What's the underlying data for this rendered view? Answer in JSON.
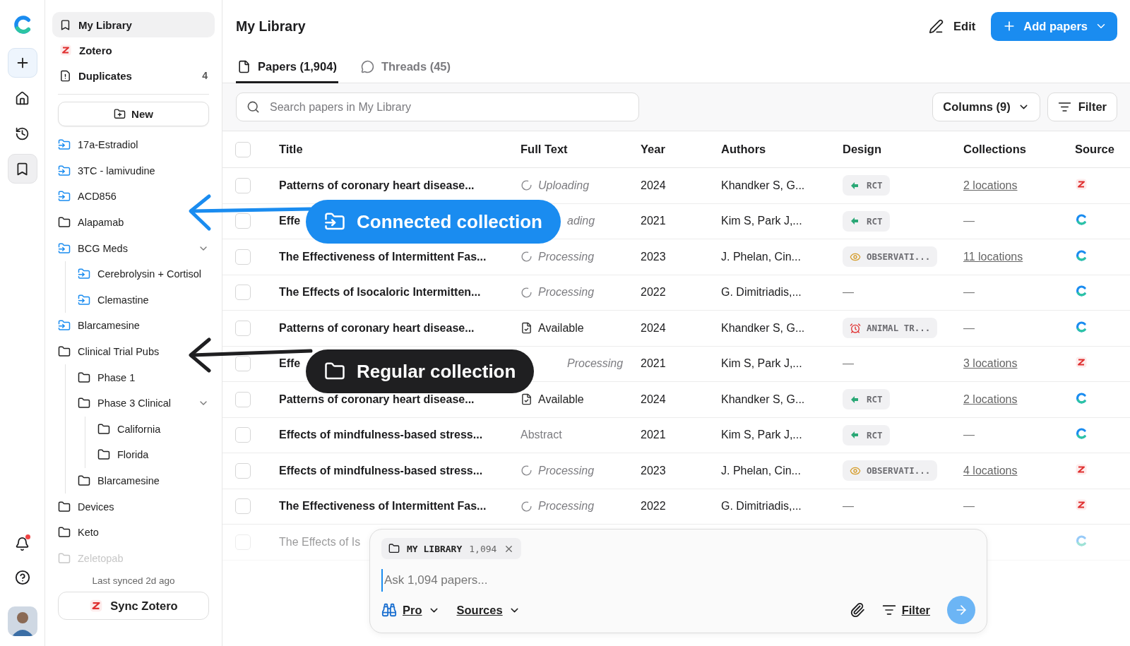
{
  "rail": {
    "nav": [
      {
        "kind": "new",
        "selected": false
      },
      {
        "kind": "home",
        "selected": false
      },
      {
        "kind": "history",
        "selected": false
      },
      {
        "kind": "library",
        "selected": true
      }
    ],
    "notifications_unread": true
  },
  "sidebar": {
    "top": [
      {
        "kind": "library",
        "label": "My Library",
        "selected": true
      },
      {
        "kind": "zotero",
        "label": "Zotero",
        "selected": false
      },
      {
        "kind": "duplicates",
        "label": "Duplicates",
        "count": "4",
        "selected": false
      }
    ],
    "new_button": "New",
    "collections": [
      {
        "label": "17a-Estradiol",
        "kind": "connected",
        "disabled": false
      },
      {
        "label": "3TC - lamivudine",
        "kind": "connected",
        "disabled": false
      },
      {
        "label": "ACD856",
        "kind": "connected",
        "disabled": false
      },
      {
        "label": "Alapamab",
        "kind": "folder",
        "disabled": false
      },
      {
        "label": "BCG Meds",
        "kind": "connected",
        "disabled": false,
        "expanded": true,
        "children": [
          {
            "label": "Cerebrolysin + Cortisol",
            "kind": "connected",
            "disabled": false
          },
          {
            "label": "Clemastine",
            "kind": "connected",
            "disabled": false
          }
        ]
      },
      {
        "label": "Blarcamesine",
        "kind": "connected",
        "disabled": false
      },
      {
        "label": "Clinical Trial Pubs",
        "kind": "folder",
        "disabled": false,
        "children": [
          {
            "label": "Phase 1",
            "kind": "folder",
            "disabled": false
          },
          {
            "label": "Phase 3 Clinical",
            "kind": "folder",
            "disabled": false,
            "expanded": true,
            "children": [
              {
                "label": "California",
                "kind": "folder",
                "disabled": false
              },
              {
                "label": "Florida",
                "kind": "folder",
                "disabled": false
              }
            ]
          },
          {
            "label": "Blarcamesine",
            "kind": "folder",
            "disabled": false
          }
        ]
      },
      {
        "label": "Devices",
        "kind": "folder",
        "disabled": false
      },
      {
        "label": "Keto",
        "kind": "folder",
        "disabled": false
      },
      {
        "label": "Zeletopab",
        "kind": "folder",
        "disabled": true
      }
    ],
    "sync_status": "Last synced 2d ago",
    "sync_button": "Sync Zotero"
  },
  "header": {
    "title": "My Library",
    "edit": "Edit",
    "add": "Add papers"
  },
  "tabs": [
    {
      "kind": "papers",
      "label": "Papers (1,904)",
      "selected": true
    },
    {
      "kind": "threads",
      "label": "Threads (45)",
      "selected": false
    }
  ],
  "search": {
    "placeholder": "Search papers in My Library"
  },
  "columns_button": "Columns (9)",
  "filter_button": "Filter",
  "table": {
    "select_all": false,
    "columns": [
      "Title",
      "Full Text",
      "Year",
      "Authors",
      "Design",
      "Collections",
      "Source"
    ],
    "rows": [
      {
        "checked": false,
        "faded": false,
        "title": "Patterns of coronary heart disease...",
        "full_text": {
          "kind": "pending",
          "text": "Uploading",
          "icon": true
        },
        "year": "2024",
        "authors": "Khandker S, G...",
        "design": {
          "kind": "rct",
          "label": "RCT"
        },
        "collections": {
          "kind": "link",
          "text": "2 locations"
        },
        "source": {
          "kind": "zotero"
        }
      },
      {
        "checked": false,
        "faded": false,
        "title": "Effe",
        "full_text": {
          "kind": "pending",
          "text": "ading",
          "icon": false
        },
        "year": "2021",
        "authors": "Kim S, Park J,...",
        "design": {
          "kind": "rct",
          "label": "RCT"
        },
        "collections": {
          "kind": "none",
          "text": "—"
        },
        "source": {
          "kind": "consensus"
        }
      },
      {
        "checked": false,
        "faded": false,
        "title": "The Effectiveness of Intermittent Fas...",
        "full_text": {
          "kind": "pending",
          "text": "Processing",
          "icon": true
        },
        "year": "2023",
        "authors": "J. Phelan, Cin...",
        "design": {
          "kind": "observational",
          "label": "OBSERVATI..."
        },
        "collections": {
          "kind": "link",
          "text": "11 locations"
        },
        "source": {
          "kind": "consensus"
        }
      },
      {
        "checked": false,
        "faded": false,
        "title": "The Effects of Isocaloric Intermitten...",
        "full_text": {
          "kind": "pending",
          "text": "Processing",
          "icon": true
        },
        "year": "2022",
        "authors": "G. Dimitriadis,...",
        "design": {
          "kind": "none",
          "label": "—"
        },
        "collections": {
          "kind": "none",
          "text": "—"
        },
        "source": {
          "kind": "consensus"
        }
      },
      {
        "checked": false,
        "faded": false,
        "title": "Patterns of coronary heart disease...",
        "full_text": {
          "kind": "available",
          "text": "Available",
          "icon": true
        },
        "year": "2024",
        "authors": "Khandker S, G...",
        "design": {
          "kind": "animal",
          "label": "ANIMAL TR..."
        },
        "collections": {
          "kind": "none",
          "text": "—"
        },
        "source": {
          "kind": "consensus"
        }
      },
      {
        "checked": false,
        "faded": false,
        "title": "Effe",
        "full_text": {
          "kind": "pending",
          "text": "Processing",
          "icon": false
        },
        "year": "2021",
        "authors": "Kim S, Park J,...",
        "design": {
          "kind": "none",
          "label": "—"
        },
        "collections": {
          "kind": "link",
          "text": "3 locations"
        },
        "source": {
          "kind": "zotero"
        }
      },
      {
        "checked": false,
        "faded": false,
        "title": "Patterns of coronary heart disease...",
        "full_text": {
          "kind": "available",
          "text": "Available",
          "icon": true
        },
        "year": "2024",
        "authors": "Khandker S, G...",
        "design": {
          "kind": "rct",
          "label": "RCT"
        },
        "collections": {
          "kind": "link",
          "text": "2 locations"
        },
        "source": {
          "kind": "consensus"
        }
      },
      {
        "checked": false,
        "faded": false,
        "title": "Effects of mindfulness-based stress...",
        "full_text": {
          "kind": "abstract",
          "text": "Abstract"
        },
        "year": "2021",
        "authors": "Kim S, Park J,...",
        "design": {
          "kind": "rct",
          "label": "RCT"
        },
        "collections": {
          "kind": "none",
          "text": "—"
        },
        "source": {
          "kind": "consensus"
        }
      },
      {
        "checked": false,
        "faded": false,
        "title": "Effects of mindfulness-based stress...",
        "full_text": {
          "kind": "pending",
          "text": "Processing",
          "icon": true
        },
        "year": "2023",
        "authors": "J. Phelan, Cin...",
        "design": {
          "kind": "observational",
          "label": "OBSERVATI..."
        },
        "collections": {
          "kind": "link",
          "text": "4 locations"
        },
        "source": {
          "kind": "zotero"
        }
      },
      {
        "checked": false,
        "faded": false,
        "title": "The Effectiveness of Intermittent Fas...",
        "full_text": {
          "kind": "pending",
          "text": "Processing",
          "icon": true
        },
        "year": "2022",
        "authors": "G. Dimitriadis,...",
        "design": {
          "kind": "none",
          "label": "—"
        },
        "collections": {
          "kind": "none",
          "text": "—"
        },
        "source": {
          "kind": "zotero"
        }
      },
      {
        "checked": false,
        "faded": true,
        "title": "The Effects of Is",
        "source": {
          "kind": "consensus"
        }
      }
    ]
  },
  "chat": {
    "scope_label": "MY LIBRARY",
    "scope_count": "1,094",
    "placeholder": "Ask 1,094 papers...",
    "mode": "Pro",
    "sources": "Sources",
    "filter": "Filter"
  },
  "callouts": [
    {
      "kind": "connected",
      "label": "Connected collection"
    },
    {
      "kind": "regular",
      "label": "Regular collection"
    }
  ]
}
